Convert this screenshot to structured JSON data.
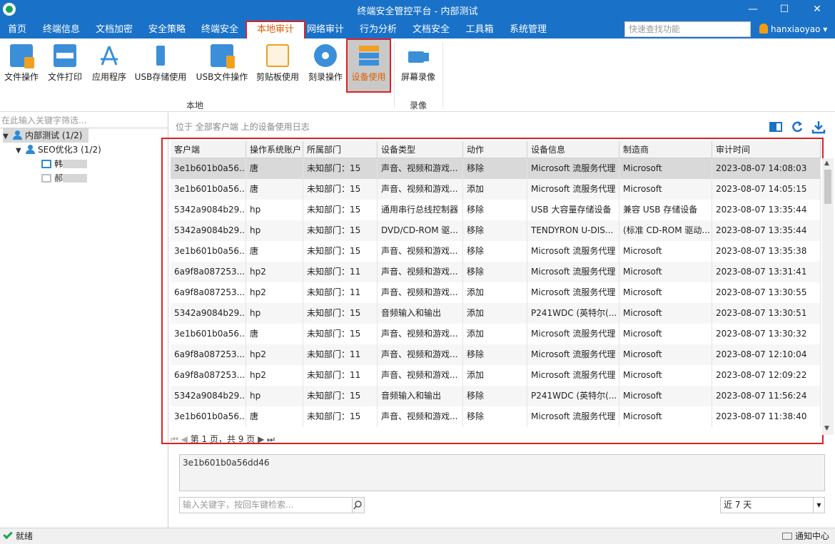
{
  "window": {
    "title": "终端安全管控平台 - 内部测试",
    "minimize": "—",
    "maximize": "☐",
    "close": "✕"
  },
  "menu": [
    {
      "label": "首页"
    },
    {
      "label": "终端信息"
    },
    {
      "label": "文档加密"
    },
    {
      "label": "安全策略"
    },
    {
      "label": "终端安全"
    },
    {
      "label": "本地审计",
      "active": true
    },
    {
      "label": "网络审计"
    },
    {
      "label": "行为分析"
    },
    {
      "label": "文档安全"
    },
    {
      "label": "工具箱"
    },
    {
      "label": "系统管理"
    }
  ],
  "search": {
    "placeholder": "快速查找功能"
  },
  "user": {
    "name": "hanxiaoyao ▾"
  },
  "ribbon": {
    "buttons": [
      {
        "label": "文件操作",
        "icon": "folder-file-icon"
      },
      {
        "label": "文件打印",
        "icon": "printer-icon"
      },
      {
        "label": "应用程序",
        "icon": "app-store-icon"
      },
      {
        "label": "USB存储使用",
        "icon": "usb-drive-icon"
      },
      {
        "label": "USB文件操作",
        "icon": "usb-folder-icon"
      },
      {
        "label": "剪贴板使用",
        "icon": "clipboard-icon"
      },
      {
        "label": "刻录操作",
        "icon": "disc-icon"
      },
      {
        "label": "设备使用",
        "icon": "device-stack-icon",
        "active": true
      },
      {
        "label": "屏幕录像",
        "icon": "video-camera-icon"
      }
    ],
    "group_local": "本地",
    "group_record": "录像"
  },
  "left": {
    "filter_placeholder": "在此输入关键字筛选...",
    "tree": {
      "root": "内部测试 (1/2)",
      "group": "SEO优化3 (1/2)",
      "client1": "韩",
      "client2": "郝"
    }
  },
  "path_text": "位于 全部客户端 上的设备使用日志",
  "grid": {
    "columns": [
      "客户端",
      "操作系统账户",
      "所属部门",
      "设备类型",
      "动作",
      "设备信息",
      "制造商",
      "审计时间"
    ],
    "rows": [
      [
        "3e1b601b0a56...",
        "唐",
        "未知部门：15",
        "声音、视频和游戏...",
        "移除",
        "Microsoft 流服务代理",
        "Microsoft",
        "2023-08-07 14:08:03"
      ],
      [
        "3e1b601b0a56...",
        "唐",
        "未知部门：15",
        "声音、视频和游戏...",
        "添加",
        "Microsoft 流服务代理",
        "Microsoft",
        "2023-08-07 14:05:15"
      ],
      [
        "5342a9084b29...",
        "hp",
        "未知部门：15",
        "通用串行总线控制器",
        "移除",
        "USB 大容量存储设备",
        "兼容 USB 存储设备",
        "2023-08-07 13:35:44"
      ],
      [
        "5342a9084b29...",
        "hp",
        "未知部门：15",
        "DVD/CD-ROM 驱...",
        "移除",
        "TENDYRON U-DIS...",
        "(标准 CD-ROM 驱动...",
        "2023-08-07 13:35:44"
      ],
      [
        "3e1b601b0a56...",
        "唐",
        "未知部门：15",
        "声音、视频和游戏...",
        "移除",
        "Microsoft 流服务代理",
        "Microsoft",
        "2023-08-07 13:35:38"
      ],
      [
        "6a9f8a087253...",
        "hp2",
        "未知部门：11",
        "声音、视频和游戏...",
        "移除",
        "Microsoft 流服务代理",
        "Microsoft",
        "2023-08-07 13:31:41"
      ],
      [
        "6a9f8a087253...",
        "hp2",
        "未知部门：11",
        "声音、视频和游戏...",
        "添加",
        "Microsoft 流服务代理",
        "Microsoft",
        "2023-08-07 13:30:55"
      ],
      [
        "5342a9084b29...",
        "hp",
        "未知部门：15",
        "音频输入和输出",
        "添加",
        "P241WDC (英特尔(...",
        "Microsoft",
        "2023-08-07 13:30:51"
      ],
      [
        "3e1b601b0a56...",
        "唐",
        "未知部门：15",
        "声音、视频和游戏...",
        "添加",
        "Microsoft 流服务代理",
        "Microsoft",
        "2023-08-07 13:30:32"
      ],
      [
        "6a9f8a087253...",
        "hp2",
        "未知部门：11",
        "声音、视频和游戏...",
        "移除",
        "Microsoft 流服务代理",
        "Microsoft",
        "2023-08-07 12:10:04"
      ],
      [
        "6a9f8a087253...",
        "hp2",
        "未知部门：11",
        "声音、视频和游戏...",
        "添加",
        "Microsoft 流服务代理",
        "Microsoft",
        "2023-08-07 12:09:22"
      ],
      [
        "5342a9084b29...",
        "hp",
        "未知部门：15",
        "音频输入和输出",
        "移除",
        "P241WDC (英特尔(...",
        "Microsoft",
        "2023-08-07 11:56:24"
      ],
      [
        "3e1b601b0a56...",
        "唐",
        "未知部门：15",
        "声音、视频和游戏...",
        "移除",
        "Microsoft 流服务代理",
        "Microsoft",
        "2023-08-07 11:38:40"
      ]
    ],
    "pager_text": "第 1 页，共 9 页"
  },
  "detail_text": "3e1b601b0a56dd46",
  "keyword": {
    "placeholder": "输入关键字，按回车键检索..."
  },
  "range": {
    "value": "近 7 天"
  },
  "status": {
    "left": "就绪",
    "right": "通知中心"
  },
  "colors": {
    "titlebar": "#1a72c8",
    "highlight": "#e02020",
    "active_text": "#e05a00"
  }
}
